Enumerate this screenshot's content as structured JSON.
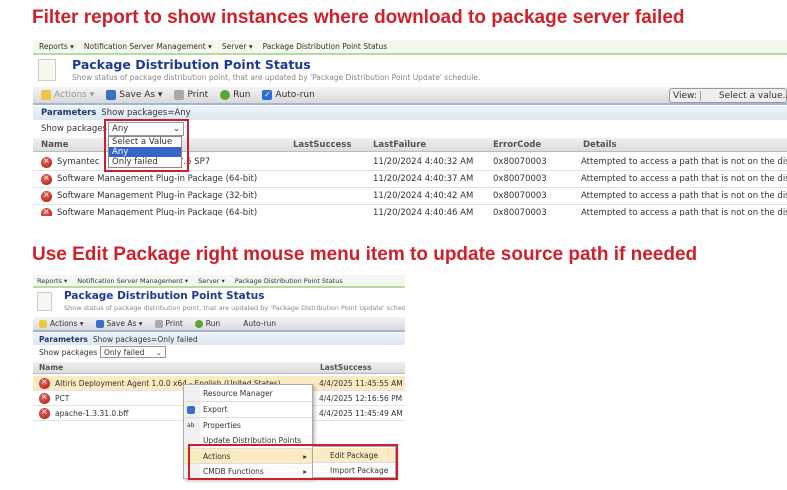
{
  "headings": {
    "top": "Filter report to show instances where download to package server failed",
    "bottom": "Use Edit Package right mouse menu item to update source path if needed"
  },
  "breadcrumb": [
    "Reports ▾",
    "Notification Server Management ▾",
    "Server ▾",
    "Package Distribution Point Status"
  ],
  "report": {
    "title": "Package Distribution Point Status",
    "subtitle": "Show status of package distribution point, that are updated by 'Package Distribution Point Update' schedule."
  },
  "toolbar": {
    "actions": "Actions ▾",
    "save_as": "Save As ▾",
    "print": "Print",
    "run": "Run",
    "auto_run": "Auto-run",
    "view_label": "View:",
    "view_value": "Select a value... ▾"
  },
  "screen1": {
    "params_label": "Parameters",
    "params_value": "Show packages=Any",
    "show_packages_label": "Show packages",
    "show_packages_value": "Any",
    "dropdown_options": [
      "Select a Value",
      "Any",
      "Only failed"
    ],
    "columns": [
      "Name",
      "LastSuccess",
      "LastFailure",
      "ErrorCode",
      "Details"
    ],
    "rows": [
      {
        "name": "Symantec",
        "name_tail": "tion 7.5 SP7",
        "last_success": "",
        "last_failure": "11/20/2024 4:40:32 AM",
        "error_code": "0x80070003",
        "details": "Attempted to access a path that is not on the disk."
      },
      {
        "name": "Software Management Plug-in Package (64-bit)",
        "last_success": "",
        "last_failure": "11/20/2024 4:40:37 AM",
        "error_code": "0x80070003",
        "details": "Attempted to access a path that is not on the disk."
      },
      {
        "name": "Software Management Plug-in Package (32-bit)",
        "last_success": "",
        "last_failure": "11/20/2024 4:40:42 AM",
        "error_code": "0x80070003",
        "details": "Attempted to access a path that is not on the disk."
      },
      {
        "name": "Software Management Plug-in Package (64-bit)",
        "last_success": "",
        "last_failure": "11/20/2024 4:40:46 AM",
        "error_code": "0x80070003",
        "details": "Attempted to access a path that is not on the disk."
      }
    ]
  },
  "screen2": {
    "params_label": "Parameters",
    "params_value": "Show packages=Only failed",
    "show_packages_label": "Show packages",
    "show_packages_value": "Only failed",
    "columns": [
      "Name",
      "LastSuccess"
    ],
    "rows": [
      {
        "name": "Altiris Deployment Agent 1.0.0 x64 - English (United States)",
        "last_success": "4/4/2025 11:45:55 AM"
      },
      {
        "name": "PCT",
        "last_success": "4/4/2025 12:16:56 PM"
      },
      {
        "name": "apache-1.3.31.0.bff",
        "last_success": "4/4/2025 11:45:49 AM"
      }
    ],
    "context_menu": [
      "Resource Manager",
      "Export",
      "Properties",
      "Update Distribution Points",
      "Actions",
      "CMDB Functions"
    ],
    "submenu": [
      "Edit Package",
      "Import Package"
    ]
  },
  "colors": {
    "accent_red": "#d0202a",
    "title_blue": "#1f3a93"
  }
}
